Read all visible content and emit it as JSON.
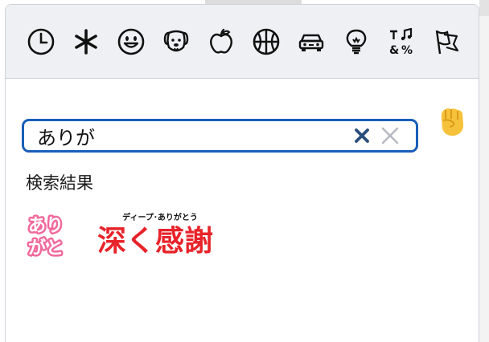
{
  "categories": [
    {
      "name": "recent",
      "icon": "clock-icon"
    },
    {
      "name": "custom",
      "icon": "asterisk-icon"
    },
    {
      "name": "people",
      "icon": "smiley-icon"
    },
    {
      "name": "nature",
      "icon": "dog-icon"
    },
    {
      "name": "food",
      "icon": "apple-icon"
    },
    {
      "name": "activity",
      "icon": "basketball-icon"
    },
    {
      "name": "travel",
      "icon": "car-icon"
    },
    {
      "name": "objects",
      "icon": "lightbulb-icon"
    },
    {
      "name": "symbols",
      "icon": "symbols-icon"
    },
    {
      "name": "flags",
      "icon": "flags-icon"
    }
  ],
  "search": {
    "value": "ありが",
    "placeholder": ""
  },
  "skin_tone_icon": "raised-fist-icon",
  "results": {
    "label": "検索結果",
    "items": [
      {
        "name": "arigato",
        "line1": "あり",
        "line2": "がと",
        "color": "#f06a9c"
      },
      {
        "name": "fukaku-kansha",
        "ruby": "ディープ･ありがとう",
        "text": "深く感謝",
        "color": "#e8232a"
      }
    ]
  },
  "colors": {
    "accent": "#1a5eb8",
    "bar_bg": "#eef0f3"
  }
}
